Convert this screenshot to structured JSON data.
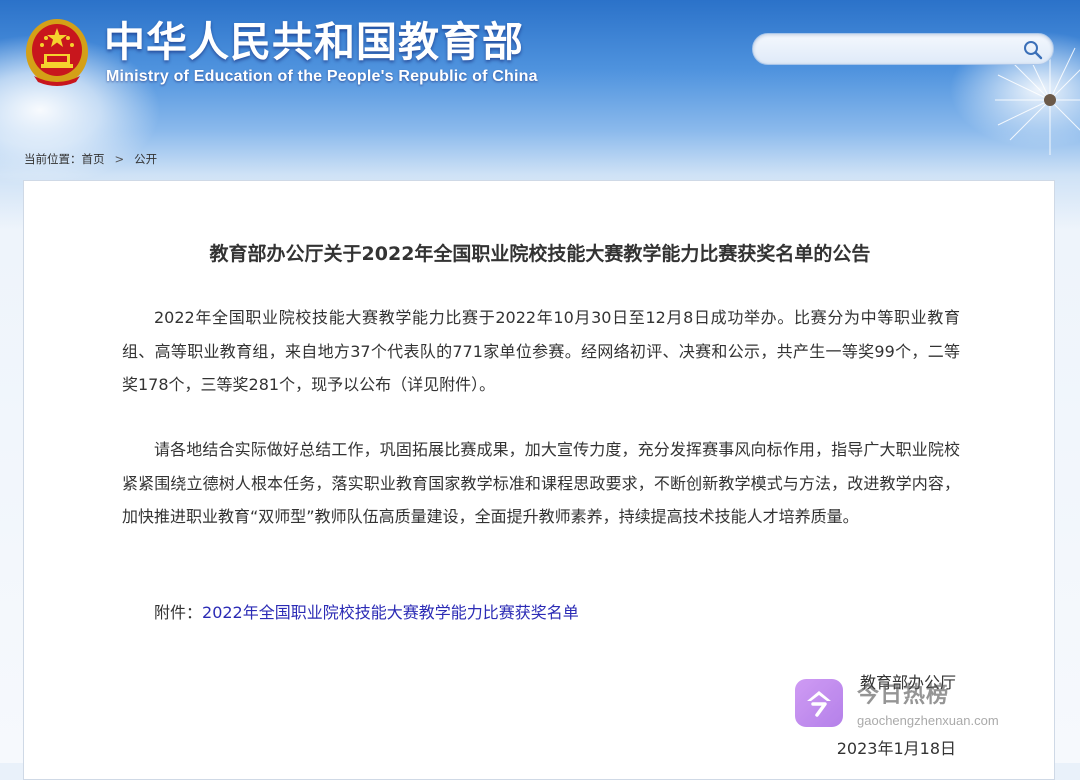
{
  "header": {
    "site_title": "中华人民共和国教育部",
    "site_subtitle": "Ministry of Education of the People's Republic of China",
    "emblem_icon": "national-emblem-icon",
    "search": {
      "placeholder": "",
      "value": "",
      "icon": "search-icon"
    }
  },
  "breadcrumb": {
    "prefix": "当前位置：",
    "items": [
      "首页",
      "公开"
    ],
    "separator": ">"
  },
  "article": {
    "title": "教育部办公厅关于2022年全国职业院校技能大赛教学能力比赛获奖名单的公告",
    "paragraphs": [
      "2022年全国职业院校技能大赛教学能力比赛于2022年10月30日至12月8日成功举办。比赛分为中等职业教育组、高等职业教育组，来自地方37个代表队的771家单位参赛。经网络初评、决赛和公示，共产生一等奖99个，二等奖178个，三等奖281个，现予以公布（详见附件）。",
      "请各地结合实际做好总结工作，巩固拓展比赛成果，加大宣传力度，充分发挥赛事风向标作用，指导广大职业院校紧紧围绕立德树人根本任务，落实职业教育国家教学标准和课程思政要求，不断创新教学模式与方法，改进教学内容，加快推进职业教育“双师型”教师队伍高质量建设，全面提升教师素养，持续提高技术技能人才培养质量。"
    ],
    "attachment_label": "附件：",
    "attachment_link": "2022年全国职业院校技能大赛教学能力比赛获奖名单",
    "issuer": "教育部办公厅",
    "date": "2023年1月18日"
  },
  "watermark": {
    "name": "今日热榜",
    "url": "gaochengzhenxuan.com"
  },
  "colors": {
    "link": "#2b2bb5",
    "header_blue": "#2b72c9",
    "text": "#333333"
  }
}
